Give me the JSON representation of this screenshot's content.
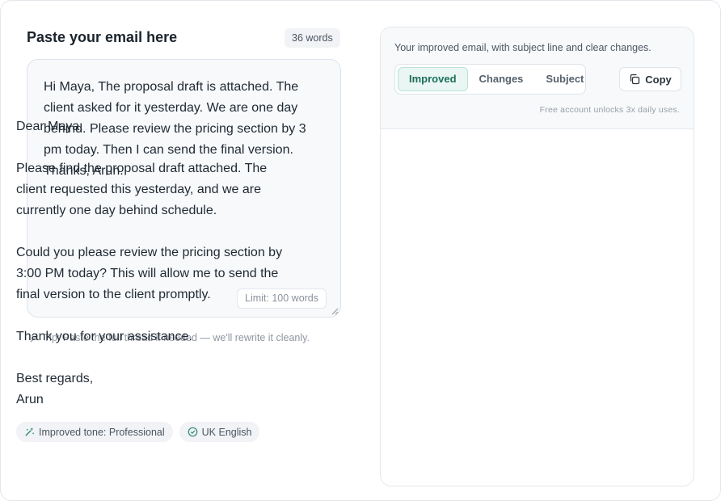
{
  "input_panel": {
    "title": "Paste your email here",
    "word_count": "36 words",
    "email_text": "Hi Maya, The proposal draft is attached. The client asked for it yesterday. We are one day behind. Please review the pricing section by 3 pm today. Then I can send the final version. Thanks, Arun.",
    "limit": "Limit: 100 words",
    "tip": "Tip: Paste the full thread if needed — we'll rewrite it cleanly."
  },
  "output_panel": {
    "subtitle": "Your improved email, with subject line and clear changes.",
    "tabs": [
      {
        "label": "Improved",
        "active": true
      },
      {
        "label": "Changes",
        "active": false
      },
      {
        "label": "Subject",
        "active": false
      }
    ],
    "copy_label": "Copy",
    "free_note": "Free account unlocks 3x daily uses.",
    "email": {
      "greeting": "Dear Maya,",
      "paragraph1": "Please find the proposal draft attached. The client requested this yesterday, and we are currently one day behind schedule.",
      "paragraph2": "Could you please review the pricing section by 3:00 PM today? This will allow me to send the final version to the client promptly.",
      "paragraph3": "Thank you for your assistance.",
      "signoff": "Best regards,",
      "name": "Arun"
    },
    "chips": [
      {
        "label": "Improved tone: Professional",
        "icon": "magic-wand-icon"
      },
      {
        "label": "UK English",
        "icon": "check-circle-icon"
      }
    ]
  },
  "colors": {
    "accent": "#1b6e5a",
    "accent_bg": "#eaf6f3"
  }
}
